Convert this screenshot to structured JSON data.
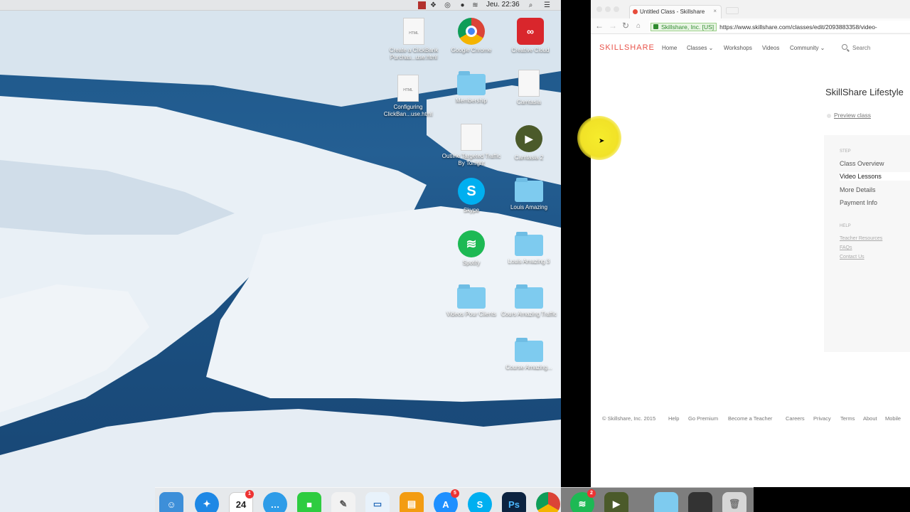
{
  "menubar": {
    "clock": "Jeu. 22:36"
  },
  "desktop": {
    "icons": [
      {
        "label": "Create a ClickBank Purchas...use.html"
      },
      {
        "label": "Google Chrome"
      },
      {
        "label": "Creative Cloud"
      },
      {
        "label": "Configuring ClickBan...use.html"
      },
      {
        "label": "Membership"
      },
      {
        "label": "Camtasia"
      },
      {
        "label": "Outline Targeted Traffic By Tonight"
      },
      {
        "label": "Camtasia 2"
      },
      {
        "label": "Skype"
      },
      {
        "label": "Louis Amazing"
      },
      {
        "label": "Spotify"
      },
      {
        "label": "Louis Amazing 3"
      },
      {
        "label": "Videos Pour Clients"
      },
      {
        "label": "Cours Amazing Traffic"
      },
      {
        "label": "Course Amazing..."
      }
    ]
  },
  "browser": {
    "tab_title": "Untitled Class - Skillshare",
    "tab_close": "×",
    "secure_label": "Skillshare, Inc. [US]",
    "url": "https://www.skillshare.com/classes/edit/2093883358/video-",
    "site": {
      "logo": "SKILLSHARE",
      "nav": [
        "Home",
        "Classes",
        "Workshops",
        "Videos",
        "Community"
      ],
      "search_placeholder": "Search"
    },
    "class_title": "SkillShare Lifestyle",
    "preview_label": "Preview class",
    "sidebar": {
      "section1": "STEP",
      "items": [
        "Class Overview",
        "Video Lessons",
        "More Details",
        "Payment Info"
      ],
      "section2": "HELP",
      "links": [
        "Teacher Resources",
        "FAQs",
        "Contact Us"
      ]
    },
    "footer": [
      "© Skillshare, Inc. 2015",
      "Help",
      "Go Premium",
      "Become a Teacher",
      "Careers",
      "Privacy",
      "Terms",
      "About",
      "Mobile"
    ]
  },
  "dock": {
    "calendar_day": "24",
    "calendar_badge": "1",
    "appstore_badge": "5",
    "spotify_badge": "2",
    "ps_label": "Ps"
  }
}
